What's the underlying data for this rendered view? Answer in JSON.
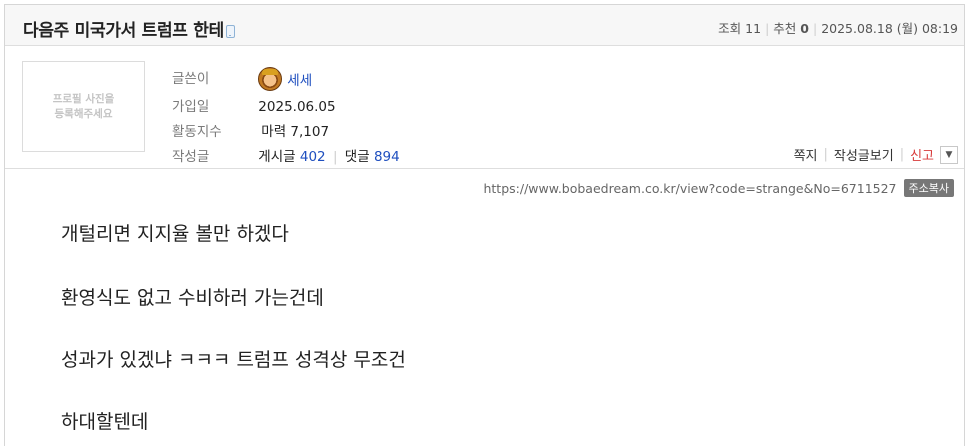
{
  "post": {
    "title": "다음주 미국가서 트럼프 한테",
    "mobile_icon": "mobile-phone-icon",
    "views_label": "조회",
    "views": "11",
    "recommend_label": "추천",
    "recommend": "0",
    "date": "2025.08.18 (월) 08:19"
  },
  "profile": {
    "photo_placeholder": "프로필 사진을\n등록해주세요",
    "nickname_label": "글쓴이",
    "nickname": "세세",
    "avatar_icon": "character-avatar-icon",
    "joined_label": "가입일",
    "joined": "2025.06.05",
    "activity_label": "활동지수",
    "activity": "마력 7,107",
    "posts_label": "작성글",
    "posts_text": "게시글",
    "posts_count": "402",
    "comments_text": "댓글",
    "comments_count": "894"
  },
  "actions": {
    "message": "쪽지",
    "view_posts": "작성글보기",
    "report": "신고",
    "dropdown_icon": "triangle-down-icon"
  },
  "url": {
    "link": "https://www.bobaedream.co.kr/view?code=strange&No=6711527",
    "copy_label": "주소복사"
  },
  "content": {
    "lines": [
      "개털리면 지지율 볼만 하겠다",
      "환영식도 없고 수비하러 가는건데",
      "성과가 있겠냐 ㅋㅋㅋ 트럼프 성격상 무조건",
      "하대할텐데"
    ]
  },
  "colors": {
    "link_blue": "#1f4fbf",
    "report_red": "#d83a3a",
    "title_bar_bg": "#f7f7f7"
  }
}
